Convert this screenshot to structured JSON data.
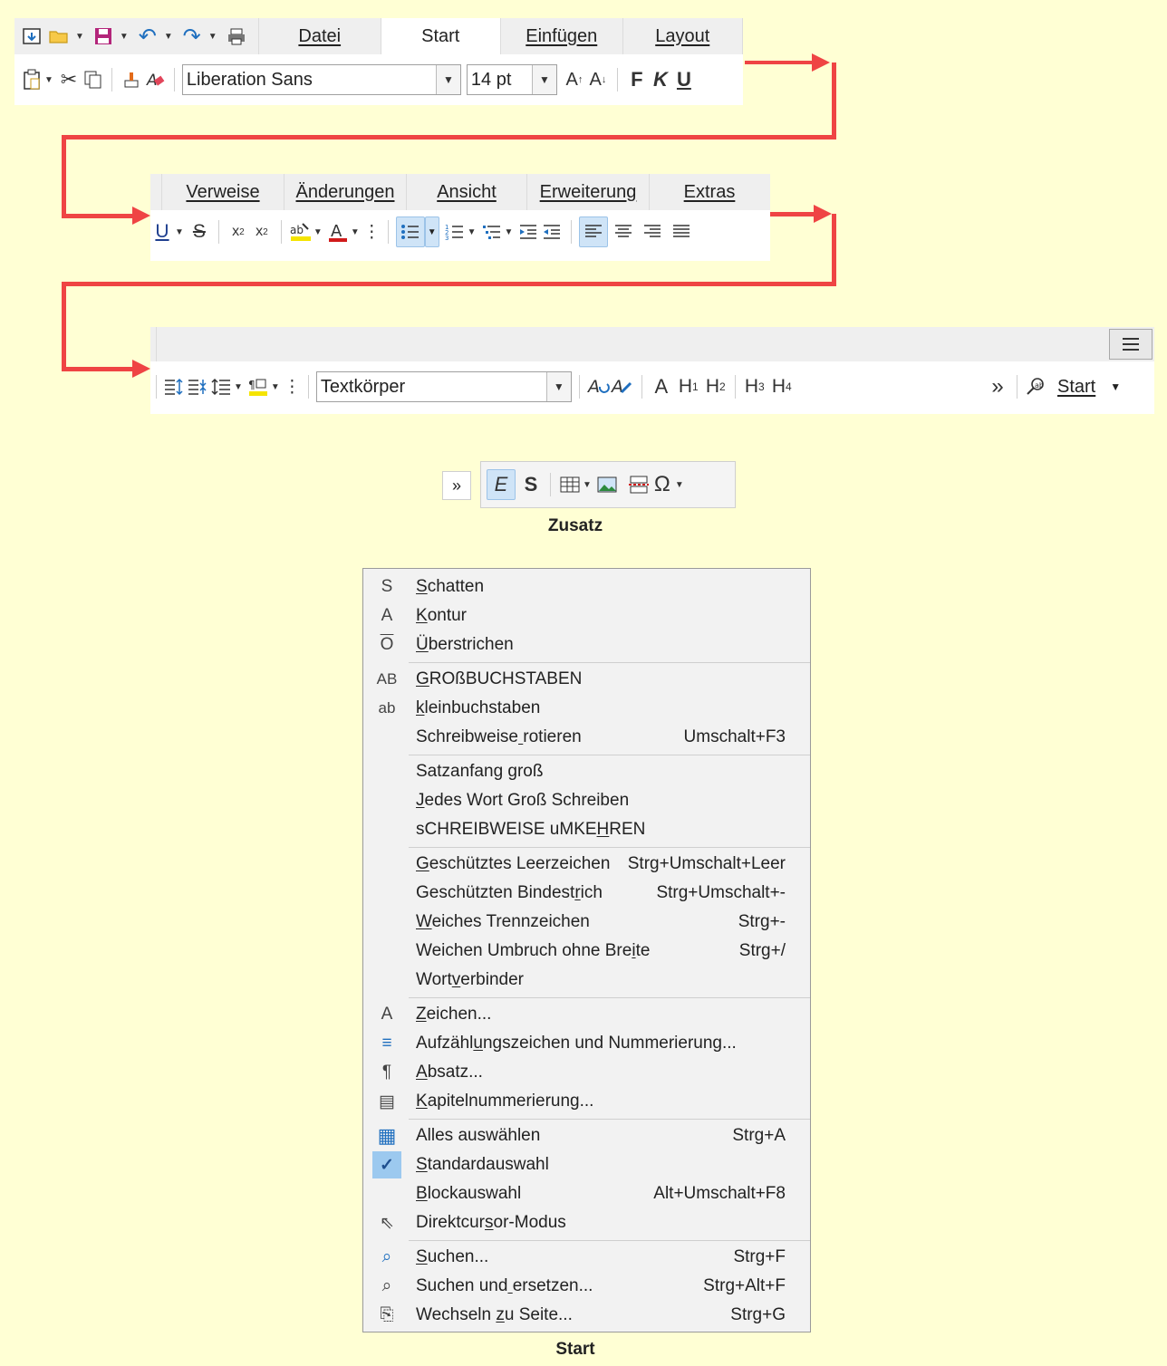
{
  "tabs_row1": [
    "Datei",
    "Start",
    "Einfügen",
    "Layout"
  ],
  "tabs_row2": [
    "Verweise",
    "Änderungen",
    "Ansicht",
    "Erweiterung",
    "Extras"
  ],
  "font_name": "Liberation Sans",
  "font_size": "14 pt",
  "bold_label": "F",
  "italic_label": "K",
  "underline_label": "U",
  "paragraph_style": "Textkörper",
  "overflow_label": "»",
  "start_dropdown_label": "Start",
  "heading_labels": [
    "A",
    "H1",
    "H2",
    "H3",
    "H4"
  ],
  "zusatz": {
    "caption": "Zusatz",
    "e_label": "E",
    "s_label": "S"
  },
  "start_caption": "Start",
  "accent_color": "#ef4444",
  "menu_items": [
    {
      "icon": "shadow-icon",
      "glyph": "S",
      "label": "Schatten",
      "shortcut": ""
    },
    {
      "icon": "outline-icon",
      "glyph": "A",
      "label": "Kontur",
      "shortcut": ""
    },
    {
      "icon": "overline-icon",
      "glyph": "O",
      "label": "Überstrichen",
      "shortcut": ""
    },
    {
      "icon": "uppercase-icon",
      "glyph": "AB",
      "label": "GROßBUCHSTABEN",
      "shortcut": ""
    },
    {
      "icon": "lowercase-icon",
      "glyph": "ab",
      "label": "kleinbuchstaben",
      "shortcut": ""
    },
    {
      "icon": "",
      "glyph": "",
      "label": "Schreibweise rotieren",
      "shortcut": "Umschalt+F3"
    },
    {
      "icon": "",
      "glyph": "",
      "label": "Satzanfang groß",
      "shortcut": ""
    },
    {
      "icon": "",
      "glyph": "",
      "label": "Jedes Wort Groß Schreiben",
      "shortcut": ""
    },
    {
      "icon": "",
      "glyph": "",
      "label": "sCHREIBWEISE uMKEHREN",
      "shortcut": ""
    },
    {
      "icon": "",
      "glyph": "",
      "label": "Geschütztes Leerzeichen",
      "shortcut": "Strg+Umschalt+Leer"
    },
    {
      "icon": "",
      "glyph": "",
      "label": "Geschützten Bindestrich",
      "shortcut": "Strg+Umschalt+-"
    },
    {
      "icon": "",
      "glyph": "",
      "label": "Weiches Trennzeichen",
      "shortcut": "Strg+-"
    },
    {
      "icon": "",
      "glyph": "",
      "label": "Weichen Umbruch ohne Breite",
      "shortcut": "Strg+/"
    },
    {
      "icon": "",
      "glyph": "",
      "label": "Wortverbinder",
      "shortcut": ""
    },
    {
      "icon": "character-icon",
      "glyph": "A",
      "label": "Zeichen...",
      "shortcut": ""
    },
    {
      "icon": "bullets-numbering-icon",
      "glyph": "≡",
      "label": "Aufzählungszeichen und Nummerierung...",
      "shortcut": ""
    },
    {
      "icon": "paragraph-icon",
      "glyph": "¶",
      "label": "Absatz...",
      "shortcut": ""
    },
    {
      "icon": "chapter-numbering-icon",
      "glyph": "▤",
      "label": "Kapitelnummerierung...",
      "shortcut": ""
    },
    {
      "icon": "select-all-icon",
      "glyph": "▦",
      "label": "Alles auswählen",
      "shortcut": "Strg+A"
    },
    {
      "icon": "check-icon",
      "glyph": "✓",
      "label": "Standardauswahl",
      "shortcut": ""
    },
    {
      "icon": "",
      "glyph": "",
      "label": "Blockauswahl",
      "shortcut": "Alt+Umschalt+F8"
    },
    {
      "icon": "cursor-icon",
      "glyph": "⇖",
      "label": "Direktcursor-Modus",
      "shortcut": ""
    },
    {
      "icon": "search-icon",
      "glyph": "⌕",
      "label": "Suchen...",
      "shortcut": "Strg+F"
    },
    {
      "icon": "find-replace-icon",
      "glyph": "⌕",
      "label": "Suchen und ersetzen...",
      "shortcut": "Strg+Alt+F"
    },
    {
      "icon": "goto-page-icon",
      "glyph": "⎘",
      "label": "Wechseln zu Seite...",
      "shortcut": "Strg+G"
    }
  ]
}
